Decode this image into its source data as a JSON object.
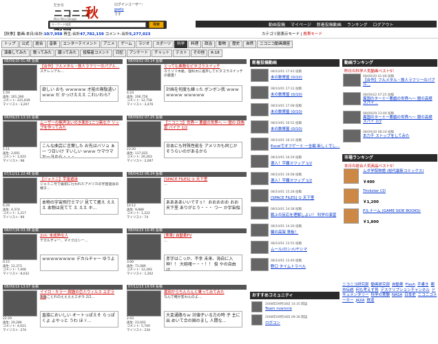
{
  "header": {
    "logo_sub": "だから",
    "logo_main": "ニコニコ動画",
    "logo_tag": "Nico Nico Douga",
    "logo_aki": "秋",
    "login_label": "ログインユーザー:",
    "login_user": "gsety",
    "login_suffix": "です",
    "search_placeholder": "キーワード検索",
    "search_button": "検索",
    "nav": [
      "動画投稿",
      "マイページ",
      "新着投稿動画",
      "ランキング",
      "ログアウト"
    ]
  },
  "stats": {
    "prefix": "【秋季】動画:本日/合計:",
    "videos_today": "10",
    "videos_total": "7,958",
    "plays_label": "再生:合計",
    "plays_total": "47,782,159",
    "comments_label": "コメント:合計",
    "comments_total": "5,277,023",
    "mode_label": "カテゴリ別表示モード",
    "mode_link": "携帯モード"
  },
  "tabs1": [
    "トップ",
    "公式",
    "総合",
    "音楽",
    "エンターテイメント",
    "アニメ",
    "ゲーム",
    "ラジオ",
    "スポーツ",
    "科学",
    "料理",
    "政治",
    "動物",
    "歴史",
    "自然",
    "ニコニコ動画講座"
  ],
  "tabs2": [
    "演奏してみた",
    "歌ってみた",
    "踊ってみた",
    "投稿者コメント",
    "日記",
    "アンケート",
    "チャット",
    "テスト",
    "その他",
    "R-18"
  ],
  "videos": [
    {
      "date": "08/09/20 01:48 投稿",
      "title": "【合作】フルメタル・鉄人ラフリーのパブル…",
      "desc": "スチレンアル…",
      "plays": "261,390",
      "comments": "221,639",
      "mylist": "3,207",
      "len": "1:59",
      "comment": "欲しい おも ｗｗｗｗｗ 才能の無駄遣い ｗｗｗ だ かっけえええ これいわら？"
    },
    {
      "date": "08/09/02 00:14 投稿",
      "title": "とっても素敵なピタゴラスイッチ",
      "desc": "カミソリ木紙、理科大に進学してピタゴラスイッチの装置！",
      "plays": "206,756",
      "comments": "12,758",
      "mylist": "3,476",
      "len": "4:24",
      "comment": "計画を何度も練った ボンボン我 ｗｗｗｗｗｗｗ ｗｗｗｗｗ"
    },
    {
      "date": "08/09/23 13:10 投稿",
      "title": "ムーザーの無声法いのき楽計1二つ画なク リップを作ってみた",
      "desc": "…",
      "plays": "2,691",
      "comments": "1,022",
      "mylist": "98",
      "len": "1:11",
      "comment": "こんな曲芸に言葉した お先はバリョ ぁ一 つ日いけ すいしい ｗｗｗ ウマウマ ヤーヨから・・・"
    },
    {
      "date": "08/09/02 07:25 投稿",
      "title": "【ニコニコ】世界一 悪戯の世界へ ～ 闇の 四角 窓 バイク 1/2",
      "desc": "…",
      "plays": "117,025",
      "comments": "20,263",
      "mylist": "2,097",
      "len": "23:20",
      "comment": "日本にも特殊性能を アメリカも同じか そうらいのがあるから"
    },
    {
      "date": "07/11/11 22:48 投稿",
      "title": "【ジェミニ】宇宙遊泳",
      "desc": "ジェミニ号で最初に行われたアメリカの宇宙遊泳の様子…",
      "plays": "4,374",
      "comments": "1,217",
      "mylist": "99",
      "len": "6:29",
      "comment": "本物の宇宙飛行士マジ 見てて癒え えええ 本物は見てて え ええ ホ…"
    },
    {
      "date": "08/04/22 06:24 投稿",
      "title": "[SPACE FILES] ① 天下里",
      "desc": "…",
      "plays": "9,888",
      "comments": "1,222",
      "mylist": "74",
      "len": "10:12",
      "comment": "ああああいいですぅ！ おおおおお おお天下里 ありがとう・・・ つー か宇宙船"
    },
    {
      "date": "08/07/26 03:38 投稿",
      "title": "2ch: 未成熟な人",
      "desc": "デカルチャー、マイクロシー…",
      "plays": "12,373",
      "comments": "7,406",
      "mylist": "8,032",
      "len": "0:15",
      "comment": "ｗｗｗｗｗｗｗｗ デカルチャー ゆうよ"
    },
    {
      "date": "08/09/23 16:45 投稿",
      "title": "[実車] 自動車FV",
      "desc": "…",
      "plays": "71,089",
      "comments": "12,283",
      "mylist": "1,262",
      "len": "3:00",
      "comment": "赤字はこっか、不幸 未来、海自に入 神！！ 大砲魂ー・・！！ 俊 やの自由 は…"
    },
    {
      "date": "08/09/19 13:07 投稿",
      "title": "イイロ・キラー:宿題の巨人ウィルス エボラ 2/2",
      "desc": "出張ことれのええええエボラ 2/2…",
      "plays": "20,286",
      "comments": "4,021",
      "mylist": "274",
      "len": "22:29",
      "comment": "直接においしい オートっぽえそ らっぽくよ よやっと うわ ほゞ…"
    },
    {
      "date": "07/11/13 19:59 投稿",
      "title": "堀田からちんらんと乗ってみてみた",
      "desc": "なんで俺が変わんのよ…",
      "plays": "23,002",
      "comments": "5,700",
      "mylist": "234",
      "len": "2:03",
      "comment": "大変通路ちｗ 対値子いる方の時 子 主に出 めいて合の国のまし 人間な…"
    }
  ],
  "new_title": "新着投稿動画",
  "new_items": [
    {
      "date": "08/10/01 17:42 投稿",
      "title": "未の数寄屋 (0/10)"
    },
    {
      "date": "08/10/01 17:31 投稿",
      "title": "未の数寄屋 (0/10)"
    },
    {
      "date": "08/10/01 17:08 投稿",
      "title": "未の数寄屋 (0/10)"
    },
    {
      "date": "08/10/01 16:52 投稿",
      "title": "未の数寄屋 (0/10)"
    },
    {
      "date": "08/10/01 16:31 投稿",
      "title": "Excelでオフゲーミ 一全編 新しくでし…"
    },
    {
      "date": "08/10/01 16:29 投稿",
      "title": "選入！宇覇スワップ 1/2"
    },
    {
      "date": "08/10/01 16:08 投稿",
      "title": "選入！宇覇スワップ 1/2"
    },
    {
      "date": "08/10/01 15:28 投稿",
      "title": "[SPACE FILES] ② 天下里"
    },
    {
      "date": "08/10/01 14:38 投稿",
      "title": "戦上の反応を理解しよい！ 科学の演習"
    },
    {
      "date": "08/10/01 14:30 投稿",
      "title": "鍵の高架 鉄板！"
    },
    {
      "date": "08/10/01 13:55 投稿",
      "title": "ムール/ロンメ/ヤシマ"
    },
    {
      "date": "08/10/01 13:40 投稿",
      "title": "野口 タイムトラベル"
    }
  ],
  "rank_title": "動画ランキング",
  "rank_sub": "昨日の科学人気動画ベスト5！",
  "rank_items": [
    {
      "date": "08/09/20 01:48 投稿",
      "title": "【合作】フルメタル・鉄人ラフリーのパブル…"
    },
    {
      "date": "08/09/22 07:25 投稿",
      "title": "異国のターミ一悪戯の世界へ～ 闇の高様スパイ…"
    },
    {
      "date": "08/09/29 23:00 投稿",
      "title": "異国のターミ一悪戯の世界へ～ 闇の高様スパイ 2/2"
    },
    {
      "date": "08/09/30 08:10 投稿",
      "title": "本力チ ストップをしてみた"
    }
  ],
  "ichiba_title": "市場ランキング",
  "ichiba_sub": "本日の総合人気商品ベスト5！",
  "ichiba_items": [
    {
      "title": "ムダ学院物語 (総代最新コミックス)",
      "price": "￥400"
    },
    {
      "title": "Trickster CD",
      "price": "￥1,200"
    },
    {
      "title": "P.S.ナーム (GAME SIDE BOOKS)",
      "price": "￥1,800"
    }
  ],
  "community": [
    "ニコニコ研究部",
    "動画研究部",
    "自動車",
    "Flash",
    "手書き",
    "都市伝説",
    "何も考えず見",
    "デスクリプションチャンネル",
    "ドキュメンタリー",
    "科学の実験",
    "NASA",
    "日本史",
    "ニコニコメーカー",
    "JAXA",
    "鉄道"
  ],
  "osusume_title": "おすすめコミュニティ",
  "osusume_items": [
    {
      "date": "2008年09月18日 14:35 開設",
      "title": "Team nvennre"
    },
    {
      "date": "2008年09月18日 09:36 開設",
      "title": "ロボコン"
    }
  ]
}
